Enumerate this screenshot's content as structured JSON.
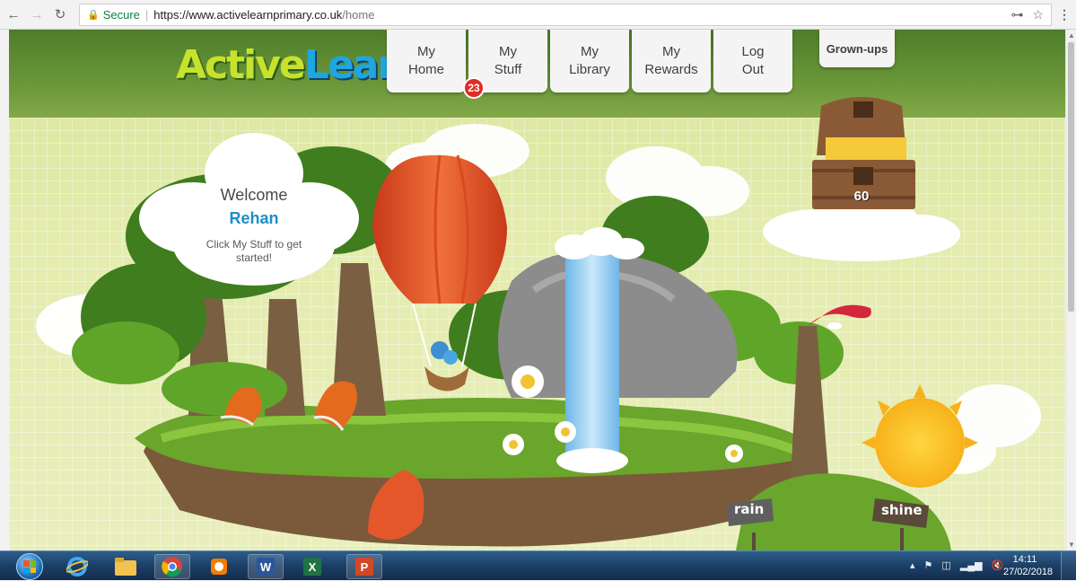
{
  "browser": {
    "back_icon": "back-arrow-icon",
    "forward_icon": "forward-arrow-icon",
    "reload_icon": "reload-icon",
    "secure_label": "Secure",
    "url_host": "https://www.activelearnprimary.co.uk",
    "url_path": "/home",
    "key_icon": "key-icon",
    "star_icon": "bookmark-star-icon",
    "menu_icon": "more-vertical-icon"
  },
  "site": {
    "logo_part1": "Active",
    "logo_part2": "Learn",
    "nav": [
      {
        "line1": "My",
        "line2": "Home"
      },
      {
        "line1": "My",
        "line2": "Stuff"
      },
      {
        "line1": "My",
        "line2": "Library"
      },
      {
        "line1": "My",
        "line2": "Rewards"
      },
      {
        "line1": "Log",
        "line2": "Out"
      }
    ],
    "stuff_badge": "23",
    "grownups_label": "Grown-ups"
  },
  "welcome": {
    "title": "Welcome",
    "name": "Rehan",
    "hint": "Click My Stuff to get started!"
  },
  "rewards": {
    "coins": "60"
  },
  "signs": {
    "rain": "rain",
    "shine": "shine"
  },
  "taskbar": {
    "apps": [
      "internet-explorer-icon",
      "file-explorer-icon",
      "chrome-icon",
      "media-player-icon",
      "word-icon",
      "excel-icon",
      "powerpoint-icon"
    ],
    "time": "14:11",
    "date": "27/02/2018"
  },
  "colors": {
    "header_green": "#5a8a30",
    "name_blue": "#1b8fc9",
    "badge_red": "#e02b26",
    "balloon_orange": "#e4572b"
  }
}
